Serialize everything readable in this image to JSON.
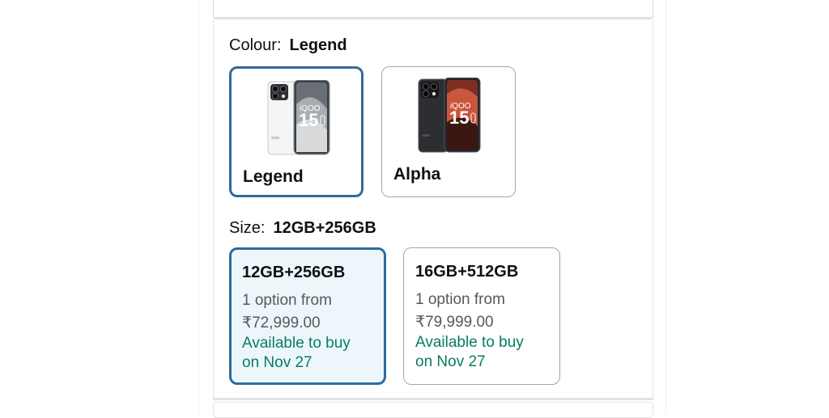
{
  "colour": {
    "label": "Colour:",
    "selected": "Legend",
    "options": [
      {
        "name": "Legend",
        "model_text": "iQOO",
        "model_num": "15"
      },
      {
        "name": "Alpha",
        "model_text": "iQOO",
        "model_num": "15"
      }
    ]
  },
  "size": {
    "label": "Size:",
    "selected": "12GB+256GB",
    "options": [
      {
        "title": "12GB+256GB",
        "offer": "1 option from",
        "price": "₹72,999.00",
        "availability_1": "Available to buy",
        "availability_2": "on Nov 27"
      },
      {
        "title": "16GB+512GB",
        "offer": "1 option from",
        "price": "₹79,999.00",
        "availability_1": "Available to buy",
        "availability_2": "on Nov 27"
      }
    ]
  },
  "colors": {
    "selected_border": "#2e6b9e",
    "available_green": "#067d62",
    "muted_text": "#565959"
  }
}
